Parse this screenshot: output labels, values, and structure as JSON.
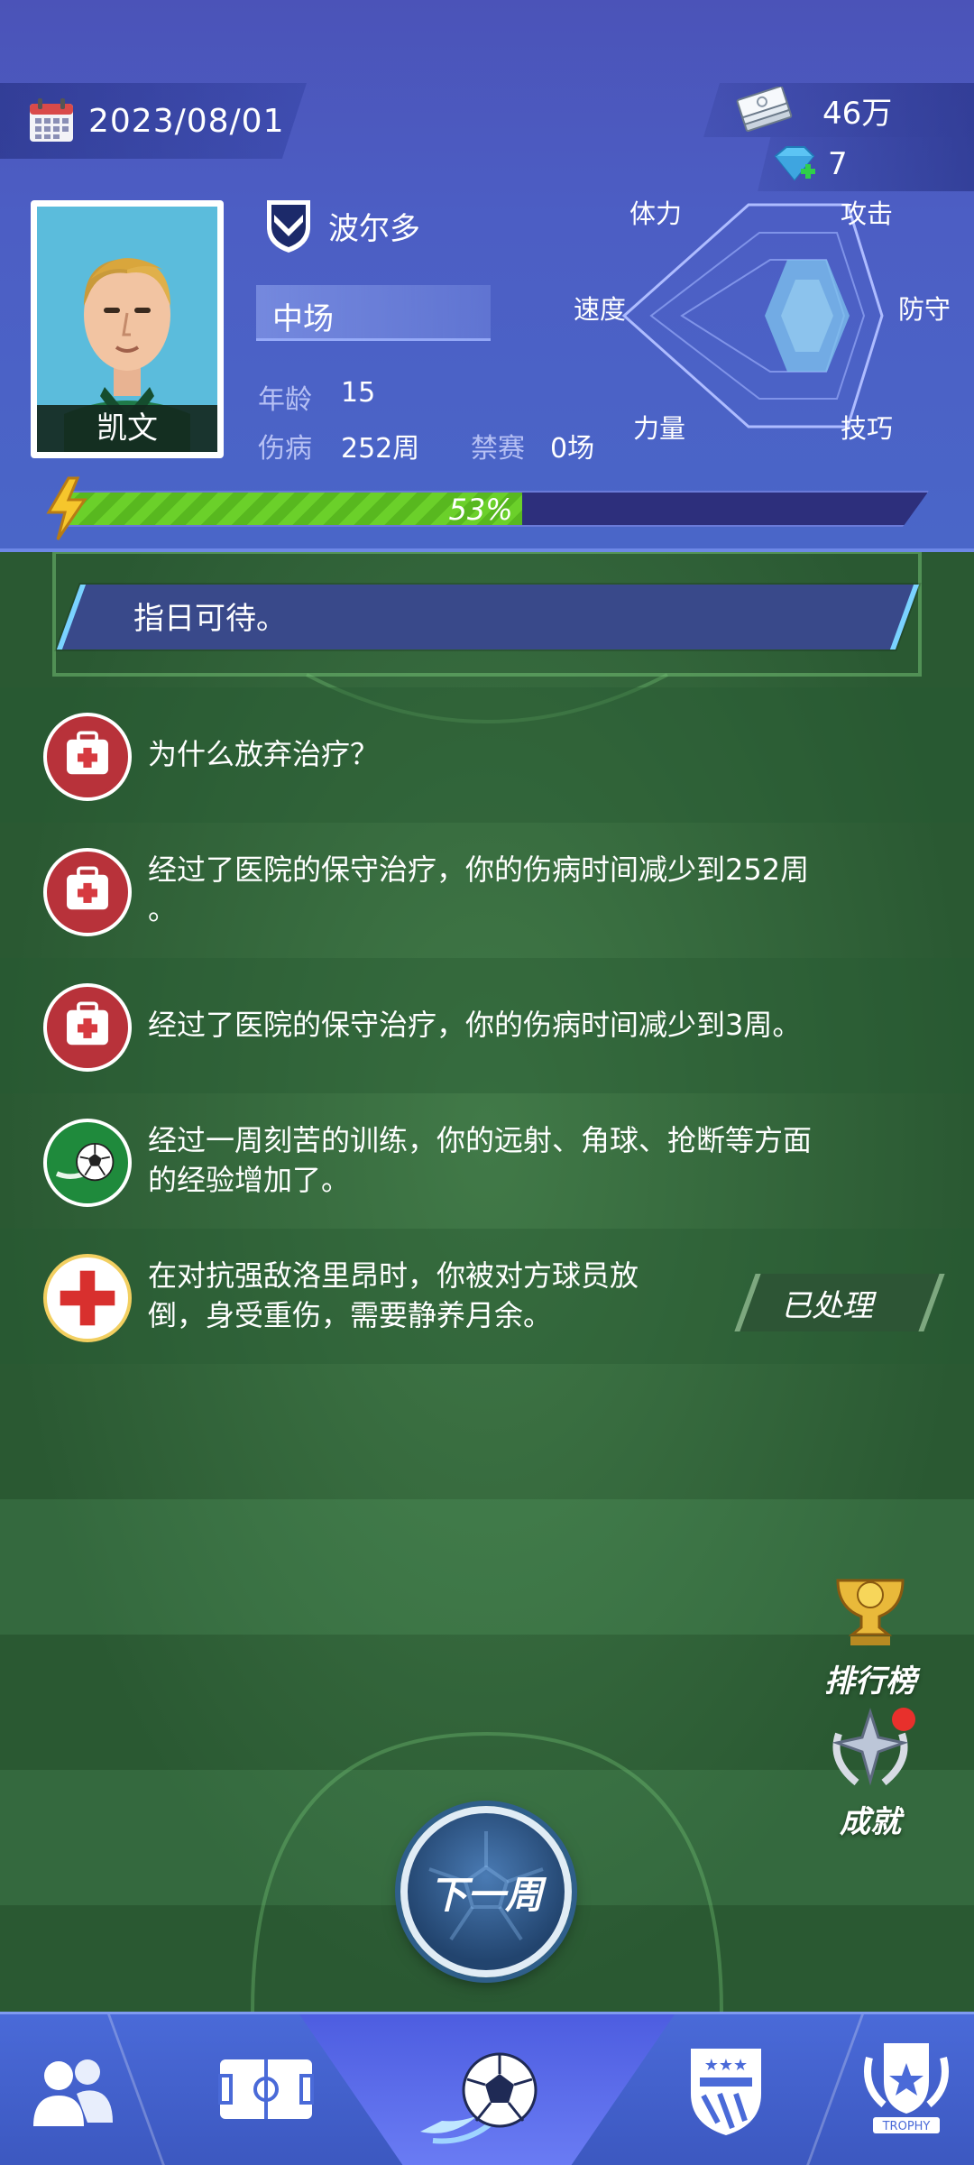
{
  "header": {
    "date": "2023/08/01",
    "cash": "46万",
    "gems": "7",
    "player_name": "凯文",
    "club_name": "波尔多",
    "position": "中场",
    "age_label": "年龄",
    "age_value": "15",
    "injury_label": "伤病",
    "injury_value": "252周",
    "suspension_label": "禁赛",
    "suspension_value": "0场",
    "progress_percent": 53,
    "progress_text": "53%",
    "attributes": {
      "stamina": "体力",
      "attack": "攻击",
      "speed": "速度",
      "defense": "防守",
      "strength": "力量",
      "technique": "技巧"
    }
  },
  "quote": "指日可待。",
  "events": [
    {
      "icon": "medkit-icon",
      "text_lines": [
        "为什么放弃治疗？"
      ]
    },
    {
      "icon": "medkit-icon",
      "text_lines": [
        "经过了医院的保守治疗，你的伤病时间减少到252周",
        "。"
      ]
    },
    {
      "icon": "medkit-icon",
      "text_lines": [
        "经过了医院的保守治疗，你的伤病时间减少到3周。"
      ]
    },
    {
      "icon": "soccer-ball-icon",
      "text_lines": [
        "经过一周刻苦的训练，你的远射、角球、抢断等方面",
        "的经验增加了。"
      ]
    },
    {
      "icon": "red-cross-icon",
      "text_lines": [
        "在对抗强敌洛里昂时，你被对方球员放",
        "倒，身受重伤，需要静养月余。"
      ],
      "status": "已处理"
    }
  ],
  "side_buttons": {
    "leaderboard": "排行榜",
    "achievements": "成就"
  },
  "next_week": "下一周",
  "nav": {
    "items": [
      "team-icon",
      "tactics-field-icon",
      "soccer-ball-icon",
      "club-badge-icon",
      "trophy-icon"
    ],
    "trophy_text": "TROPHY",
    "active_index": 2
  }
}
